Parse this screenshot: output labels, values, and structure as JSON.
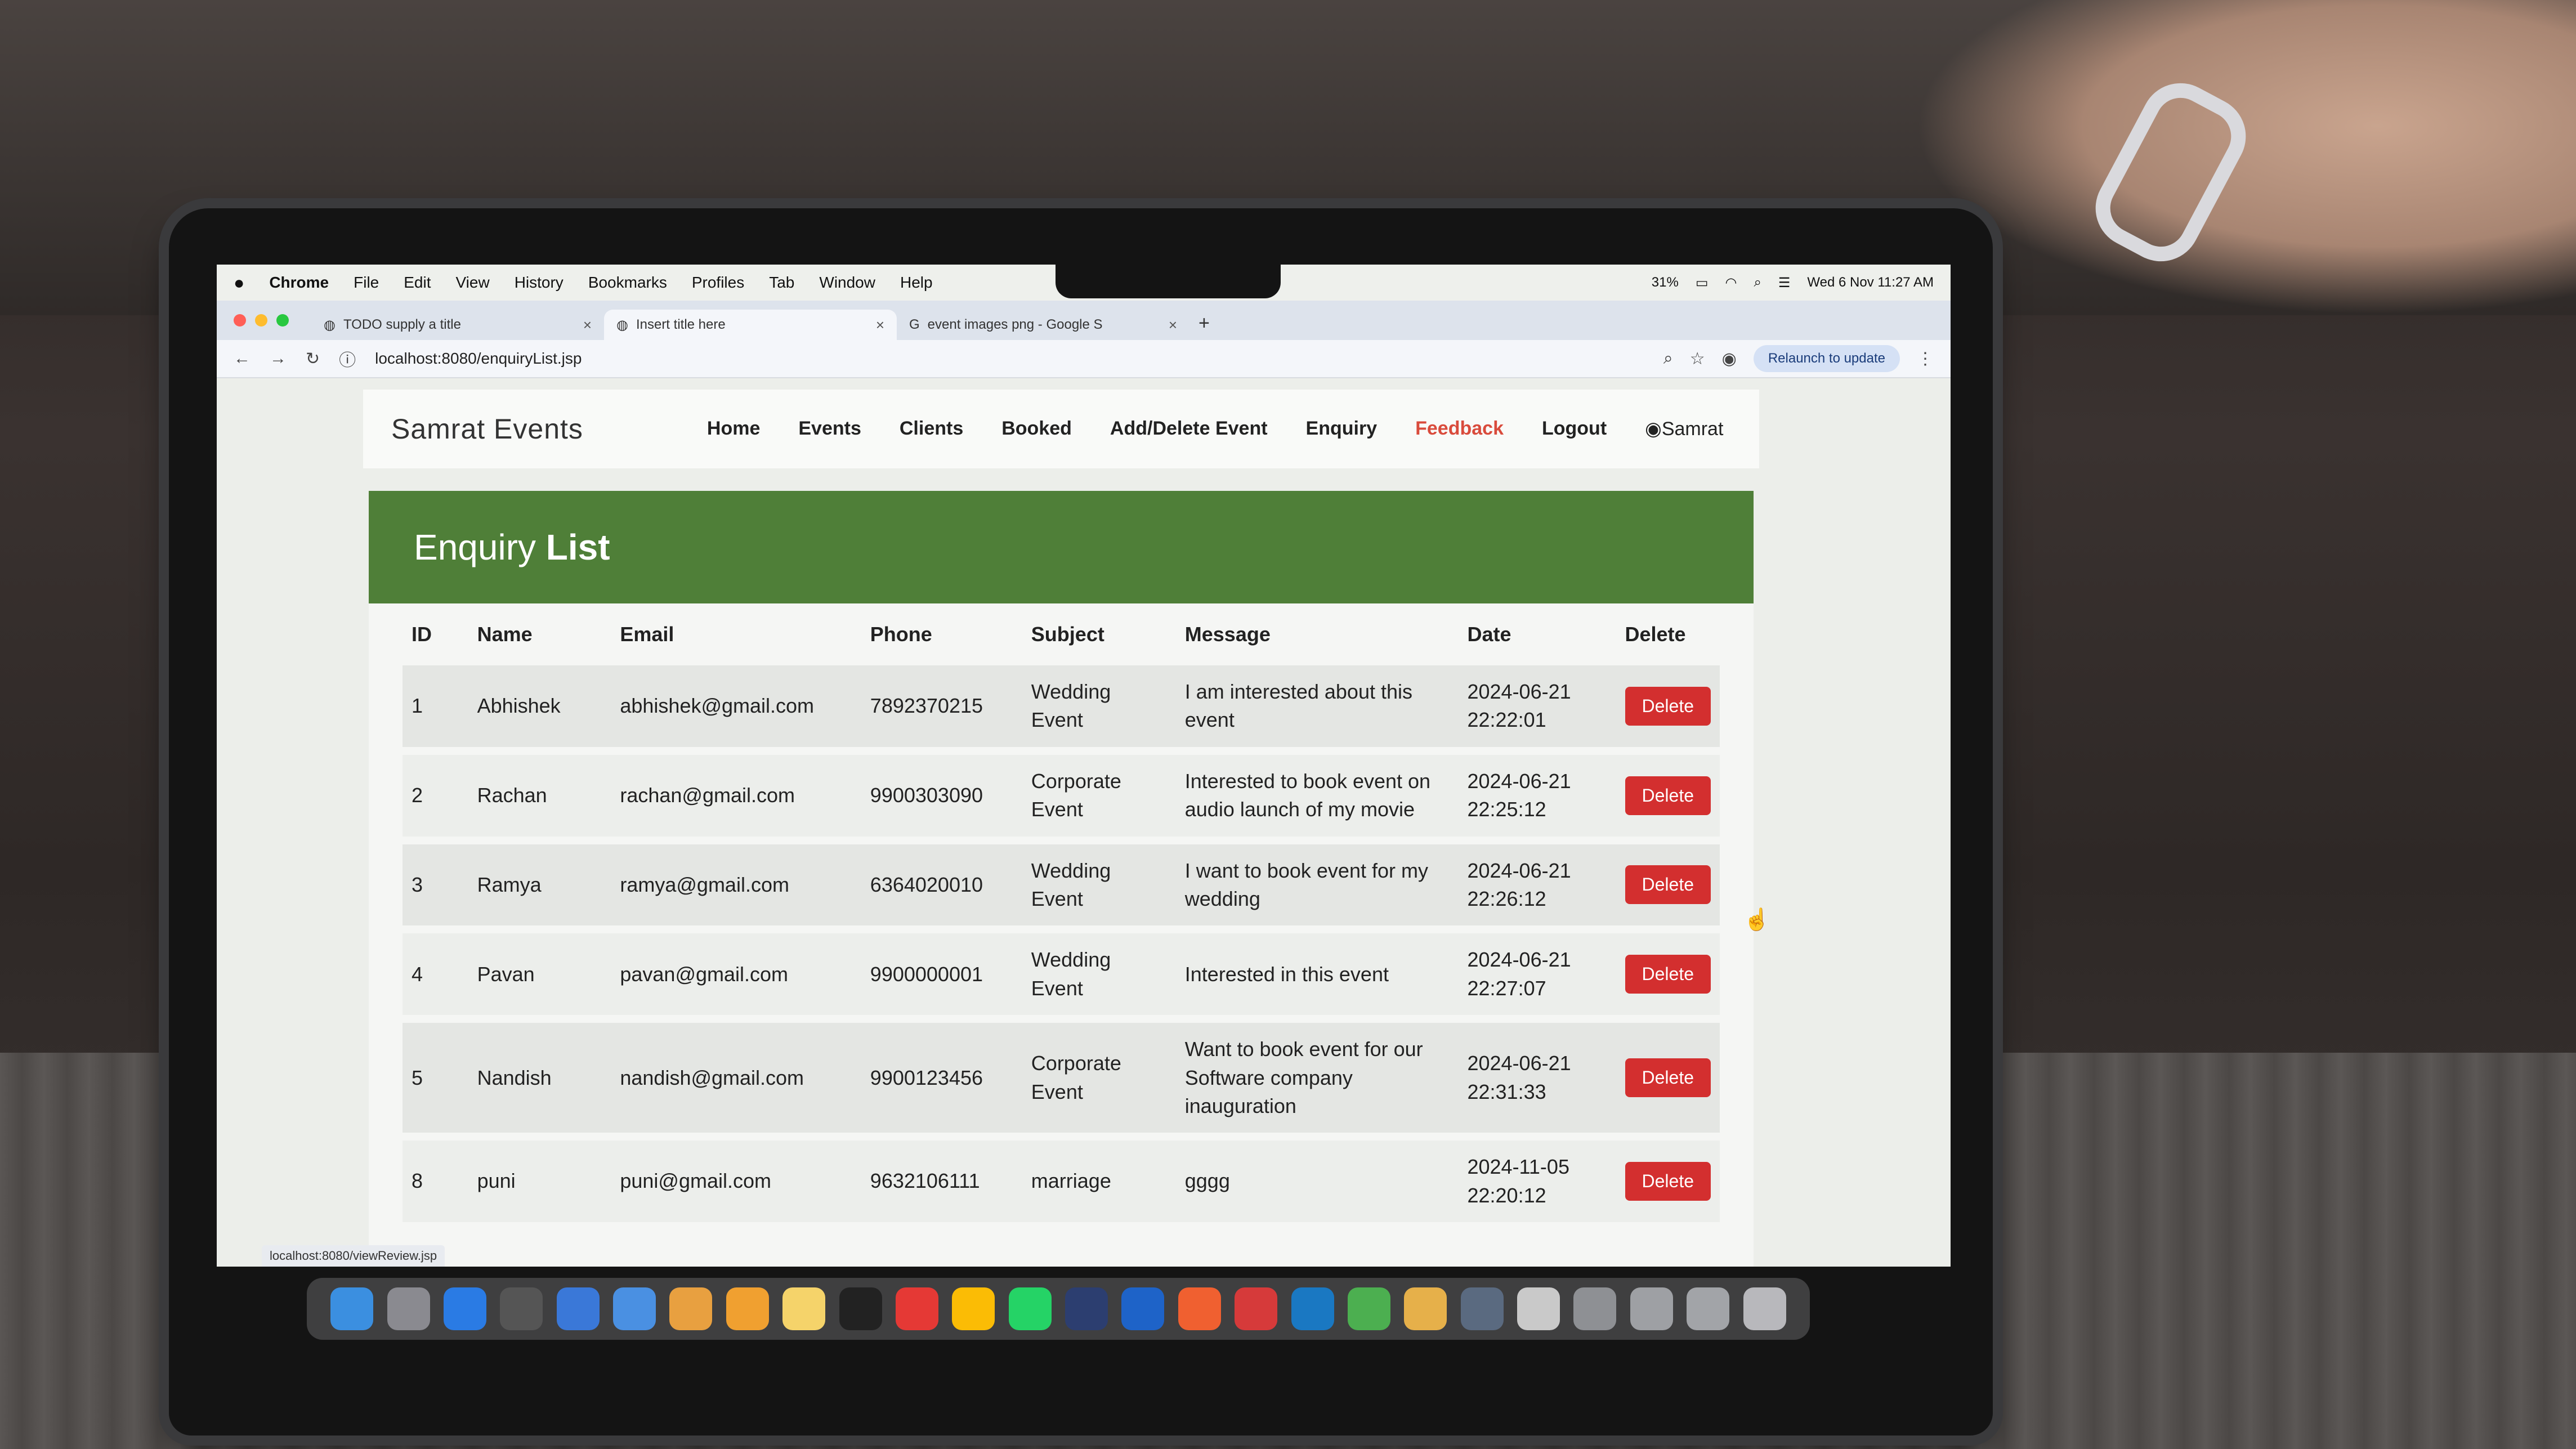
{
  "menubar": {
    "app": "Chrome",
    "items": [
      "File",
      "Edit",
      "View",
      "History",
      "Bookmarks",
      "Profiles",
      "Tab",
      "Window",
      "Help"
    ],
    "battery": "31%",
    "datetime": "Wed 6 Nov  11:27 AM"
  },
  "tabs": [
    {
      "title": "TODO supply a title",
      "close": "×"
    },
    {
      "title": "Insert title here",
      "close": "×"
    },
    {
      "title": "event images png - Google S",
      "close": "×"
    }
  ],
  "new_tab": "+",
  "address": {
    "url": "localhost:8080/enquiryList.jsp",
    "relaunch": "Relaunch to update"
  },
  "navbar": {
    "brand": "Samrat Events",
    "links": [
      "Home",
      "Events",
      "Clients",
      "Booked",
      "Add/Delete Event",
      "Enquiry",
      "Feedback",
      "Logout"
    ],
    "user": "Samrat"
  },
  "header": {
    "title_light": "Enquiry",
    "title_bold": "List"
  },
  "table": {
    "columns": [
      "ID",
      "Name",
      "Email",
      "Phone",
      "Subject",
      "Message",
      "Date",
      "Delete"
    ],
    "delete_label": "Delete",
    "rows": [
      {
        "id": "1",
        "name": "Abhishek",
        "email": "abhishek@gmail.com",
        "phone": "7892370215",
        "subject": "Wedding Event",
        "message": "I am interested about this event",
        "date": "2024-06-21 22:22:01"
      },
      {
        "id": "2",
        "name": "Rachan",
        "email": "rachan@gmail.com",
        "phone": "9900303090",
        "subject": "Corporate Event",
        "message": "Interested to book event on audio launch of my movie",
        "date": "2024-06-21 22:25:12"
      },
      {
        "id": "3",
        "name": "Ramya",
        "email": "ramya@gmail.com",
        "phone": "6364020010",
        "subject": "Wedding Event",
        "message": "I want to book event for my wedding",
        "date": "2024-06-21 22:26:12"
      },
      {
        "id": "4",
        "name": "Pavan",
        "email": "pavan@gmail.com",
        "phone": "9900000001",
        "subject": "Wedding Event",
        "message": "Interested in this event",
        "date": "2024-06-21 22:27:07"
      },
      {
        "id": "5",
        "name": "Nandish",
        "email": "nandish@gmail.com",
        "phone": "9900123456",
        "subject": "Corporate Event",
        "message": "Want to book event for our Software company inauguration",
        "date": "2024-06-21 22:31:33"
      },
      {
        "id": "8",
        "name": "puni",
        "email": "puni@gmail.com",
        "phone": "9632106111",
        "subject": "marriage",
        "message": "gggg",
        "date": "2024-11-05 22:20:12"
      }
    ]
  },
  "statusbar": "localhost:8080/viewReview.jsp",
  "colors": {
    "header_green": "#4f7f38",
    "delete_red": "#d32f2f",
    "feedback_red": "#d94b3c"
  }
}
